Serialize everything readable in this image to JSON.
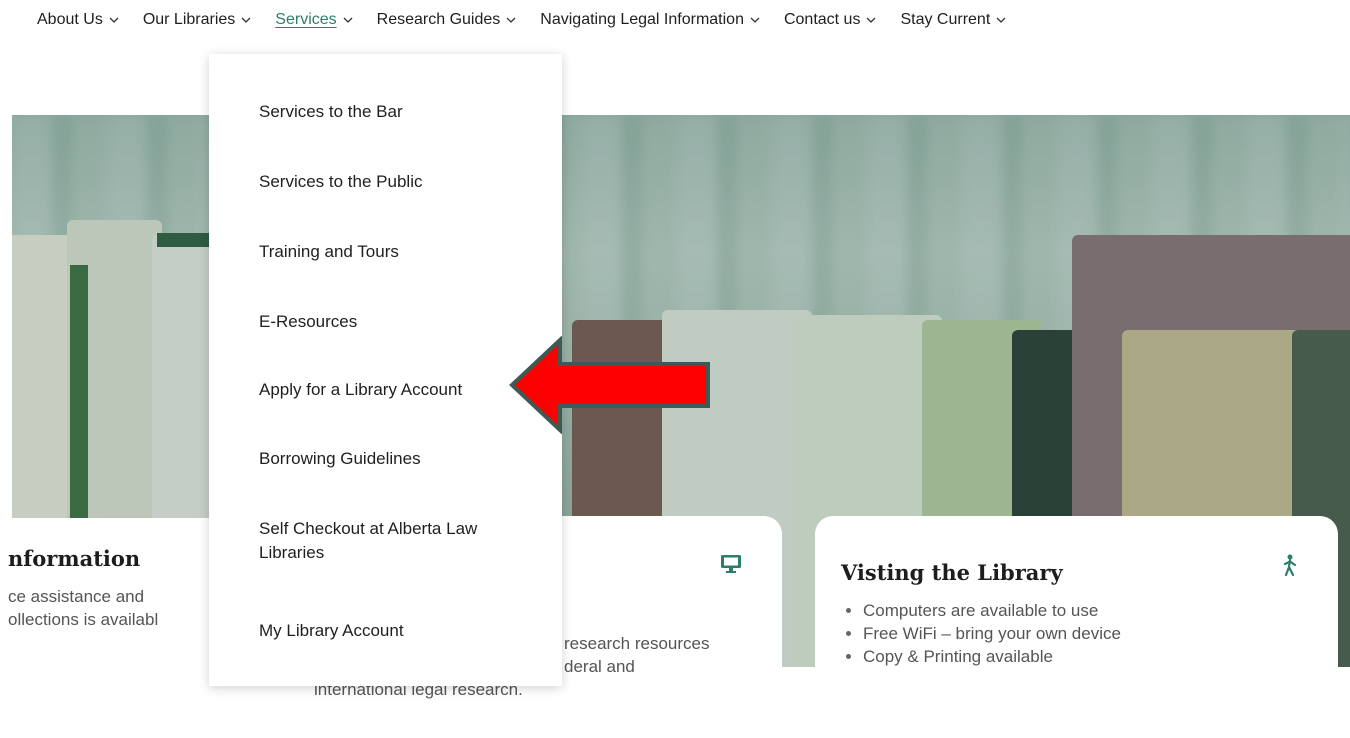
{
  "nav": {
    "items": [
      {
        "label": "About Us",
        "active": false
      },
      {
        "label": "Our Libraries",
        "active": false
      },
      {
        "label": "Services",
        "active": true
      },
      {
        "label": "Research Guides",
        "active": false
      },
      {
        "label": "Navigating Legal Information",
        "active": false
      },
      {
        "label": "Contact us",
        "active": false
      },
      {
        "label": "Stay Current",
        "active": false
      }
    ]
  },
  "dropdown": {
    "items": [
      "Services to the Bar",
      "Services to the Public",
      "Training and Tours",
      "E-Resources",
      "Apply for a Library Account",
      "Borrowing Guidelines",
      "Self Checkout at Alberta Law Libraries",
      "My Library Account"
    ]
  },
  "cards": {
    "left": {
      "title": "nformation",
      "text_line1": "ce assistance and",
      "text_line2": "ollections is availabl",
      "icon": "compass-icon"
    },
    "middle": {
      "text_line1": "research resources",
      "text_line2": "deral and",
      "text_line3": "international legal research.",
      "icon": "monitor-icon"
    },
    "right": {
      "title": "Visting the Library",
      "bullets": [
        "Computers are available to use",
        "Free WiFi – bring your own device",
        "Copy & Printing available"
      ],
      "icon": "walking-person-icon"
    }
  },
  "colors": {
    "accent": "#2e7d6b",
    "arrow": "#ff0000",
    "arrow_border": "#3d5a55"
  }
}
